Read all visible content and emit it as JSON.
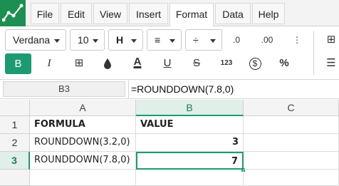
{
  "menubar": {
    "items": [
      "File",
      "Edit",
      "View",
      "Insert",
      "Format",
      "Data",
      "Help"
    ],
    "active_index": 4
  },
  "toolbar": {
    "font_name": "Verdana",
    "font_size": "10",
    "icons": {
      "align_h": "H",
      "align_v": "≡",
      "merge": "÷",
      "decrease_decimals": ".0",
      "increase_decimals": ".00",
      "bold": "B",
      "italic": "I",
      "borders": "⊞",
      "fill": "🌢",
      "text_color": "A",
      "underline": "U",
      "strike": "S",
      "number_format": "123",
      "currency": "$",
      "percent": "%"
    }
  },
  "formula_bar": {
    "cell_ref": "B3",
    "formula": "=ROUNDDOWN(7.8,0)"
  },
  "grid": {
    "columns": [
      "A",
      "B",
      "C"
    ],
    "rows": [
      {
        "num": "1",
        "a": "FORMULA",
        "b": "VALUE"
      },
      {
        "num": "2",
        "a": "ROUNDDOWN(3.2,0)",
        "b": "3"
      },
      {
        "num": "3",
        "a": "ROUNDDOWN(7.8,0)",
        "b": "7"
      },
      {
        "num": "",
        "a": "",
        "b": ""
      }
    ],
    "selected_cell": "B3"
  },
  "colors": {
    "accent": "#1e9a72",
    "logo": "#1e8f52"
  }
}
